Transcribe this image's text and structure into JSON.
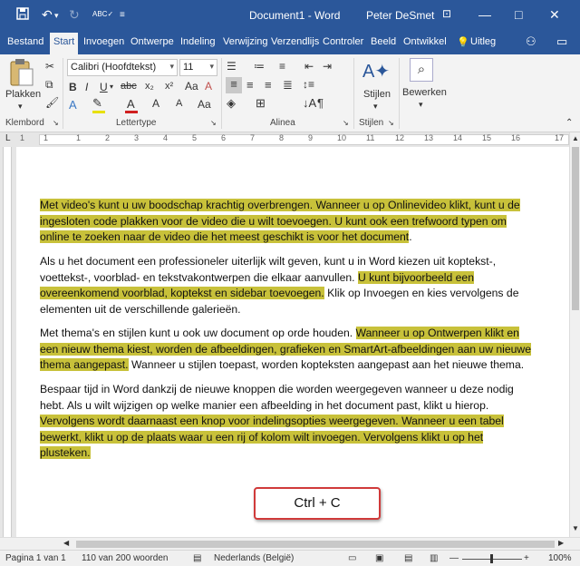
{
  "titlebar": {
    "document_title": "Document1  -  Word",
    "user": "Peter DeSmet",
    "minimize": "—",
    "maximize": "□",
    "close": "✕"
  },
  "tabs": [
    "Bestand",
    "Start",
    "Invoegen",
    "Ontwerpe",
    "Indeling",
    "Verwijzing",
    "Verzendlijs",
    "Controler",
    "Beeld",
    "Ontwikkel",
    "Uitleg"
  ],
  "ribbon": {
    "groups": {
      "clipboard": "Klembord",
      "font": "Lettertype",
      "paragraph": "Alinea",
      "styles": "Stijlen"
    },
    "paste_label": "Plakken",
    "styles_label": "Stijlen",
    "editing_label": "Bewerken",
    "font_name": "Calibri (Hoofdtekst)",
    "font_size": "11",
    "bold": "B",
    "italic": "I",
    "underline": "U",
    "strike": "abc",
    "subscript": "x₂",
    "superscript": "x²",
    "font_color": "A"
  },
  "ruler": {
    "numbers": [
      "1",
      "2",
      "1",
      "2",
      "3",
      "4",
      "5",
      "6",
      "7",
      "8",
      "9",
      "10",
      "11",
      "12",
      "13",
      "14",
      "15",
      "16",
      "17"
    ]
  },
  "document": {
    "p1_line1": "Met video's kunt u uw boodschap krachtig overbrengen. Wanneer u op Onlinevideo klikt, kunt u de",
    "p1_line2": "ingesloten code plakken voor de video die u wilt toevoegen. U kunt ook een trefwoord typen om",
    "p1_line3": "online te zoeken naar de video die het meest geschikt is voor het document",
    "p1_end": ".",
    "p2_line1": "Als u het document een professioneler uiterlijk wilt geven, kunt u in Word kiezen uit koptekst-,",
    "p2_line2a": "voettekst-, voorblad- en tekstvakontwerpen die elkaar aanvullen. ",
    "p2_line2b": "U kunt bijvoorbeeld een",
    "p2_line3a": "overeenkomend voorblad, koptekst en sidebar toevoegen.",
    "p2_line3b": " Klik op Invoegen en kies vervolgens de",
    "p2_line4": "elementen uit de verschillende galerieën.",
    "p3_line1a": "Met thema's en stijlen kunt u ook uw document op orde houden. ",
    "p3_line1b": "Wanneer u op Ontwerpen klikt en",
    "p3_line2": "een nieuw thema kiest, worden de afbeeldingen, grafieken en SmartArt-afbeeldingen aan uw nieuwe",
    "p3_line3a": "thema aangepast.",
    "p3_line3b": " Wanneer u stijlen toepast, worden kopteksten aangepast aan het nieuwe thema.",
    "p4_line1": "Bespaar tijd in Word dankzij de nieuwe knoppen die worden weergegeven wanneer u deze nodig",
    "p4_line2": "hebt. Als u wilt wijzigen op welke manier een afbeelding in het document past, klikt u hierop.",
    "p4_line3": "Vervolgens wordt daarnaast een knop voor indelingsopties weergegeven. Wanneer u een tabel",
    "p4_line4": "bewerkt, klikt u op de plaats waar u een rij of kolom wilt invoegen. Vervolgens klikt u op het",
    "p4_line5": "plusteken."
  },
  "overlay": {
    "shortcut": "Ctrl  + C"
  },
  "statusbar": {
    "page": "Pagina 1 van 1",
    "words": "110 van 200 woorden",
    "language": "Nederlands (België)",
    "zoom": "100%"
  },
  "colors": {
    "title_bar": "#2b579a",
    "highlight": "#c8c13a",
    "overlay_border": "#d03a3a"
  }
}
